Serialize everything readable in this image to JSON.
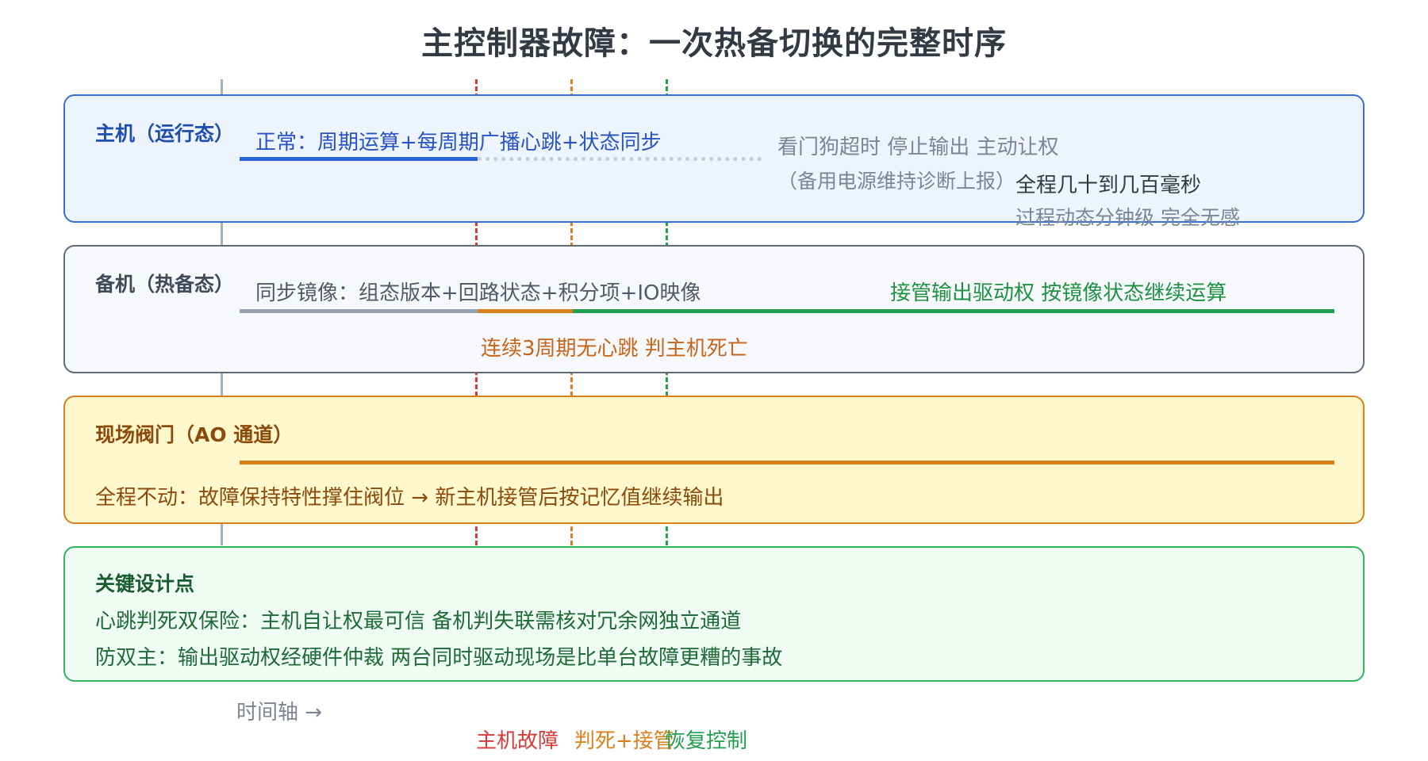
{
  "title": "主控制器故障：一次热备切换的完整时序",
  "colors": {
    "host_blue": "#3c6fd6",
    "fault_red": "#d63a3a",
    "decide_orange": "#d9801c",
    "recover_green": "#22a04d",
    "axis_gray": "#a4afbe"
  },
  "host": {
    "title": "主机（运行态）",
    "normal_text": "正常：周期运算+每周期广播心跳+状态同步",
    "watchdog_text": "看门狗超时 停止输出 主动让权",
    "backup_power_text": "（备用电源维持诊断上报）",
    "whole_time_text": "全程几十到几百毫秒",
    "process_text": "过程动态分钟级 完全无感"
  },
  "backup": {
    "title": "备机（热备态）",
    "sync_text": "同步镜像：组态版本+回路状态+积分项+IO映像",
    "takeover_text": "接管输出驱动权 按镜像状态继续运算",
    "decide_text": "连续3周期无心跳 判主机死亡"
  },
  "valve": {
    "title": "现场阀门（AO 通道）",
    "text": "全程不动：故障保持特性撑住阀位 → 新主机接管后按记忆值继续输出"
  },
  "notes": {
    "title": "关键设计点",
    "line1": "心跳判死双保险：主机自让权最可信 备机判失联需核对冗余网独立通道",
    "line2": "防双主：输出驱动权经硬件仲裁 两台同时驱动现场是比单台故障更糟的事故"
  },
  "axis": {
    "label": "时间轴 →",
    "marker_fault": "主机故障",
    "marker_decide": "判死+接管",
    "marker_recover": "恢复控制"
  }
}
